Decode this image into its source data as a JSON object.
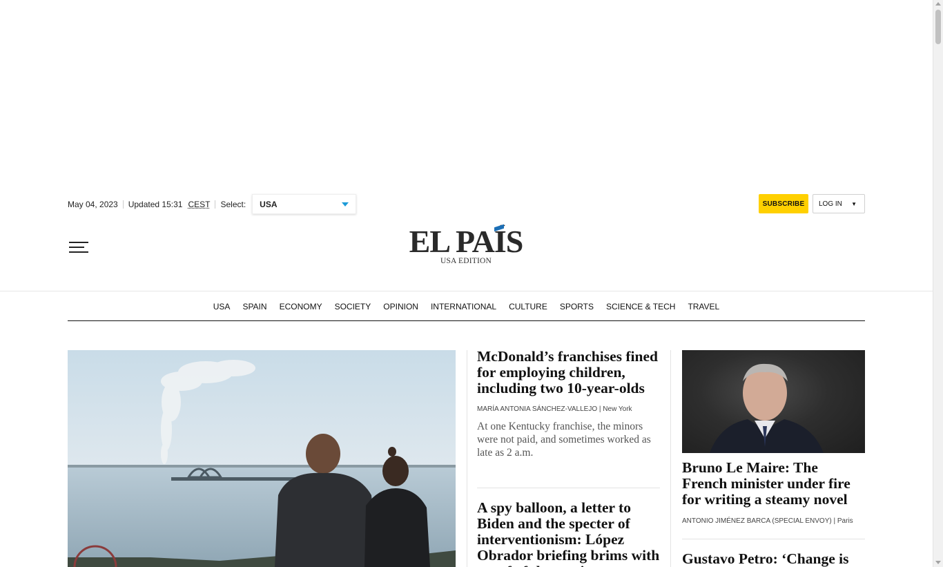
{
  "header": {
    "date": "May 04, 2023",
    "updated": "Updated 15:31",
    "timezone": "CEST",
    "select_label": "Select:",
    "edition_select_value": "USA",
    "subscribe_label": "SUBSCRIBE",
    "login_label": "LOG IN",
    "login_caret": "▼"
  },
  "logo": {
    "wordmark": "EL PAÍS",
    "edition": "USA EDITION",
    "accent_color": "#1c6fb6"
  },
  "nav": {
    "items": [
      "USA",
      "SPAIN",
      "ECONOMY",
      "SOCIETY",
      "OPINION",
      "INTERNATIONAL",
      "CULTURE",
      "SPORTS",
      "SCIENCE & TECH",
      "TRAVEL"
    ]
  },
  "stories": {
    "center": [
      {
        "headline": "McDonald’s franchises fined for employing children, including two 10-year-olds",
        "author": "MARÍA ANTONIA SÁNCHEZ-VALLEJO",
        "location": "| New York",
        "summary": "At one Kentucky franchise, the minors were not paid, and sometimes worked as late as 2 a.m."
      },
      {
        "headline": "A spy balloon, a letter to Biden and the specter of interventionism: López Obrador briefing brims with proof of the tension"
      }
    ],
    "right": [
      {
        "headline": "Bruno Le Maire: The French minister under fire for writing a steamy novel",
        "author": "ANTONIO JIMÉNEZ BARCA (SPECIAL ENVOY)",
        "location": "| Paris"
      },
      {
        "headline": "Gustavo Petro: ‘Change is"
      }
    ]
  },
  "colors": {
    "subscribe_bg": "#ffd000",
    "select_caret": "#1c9bd8"
  }
}
